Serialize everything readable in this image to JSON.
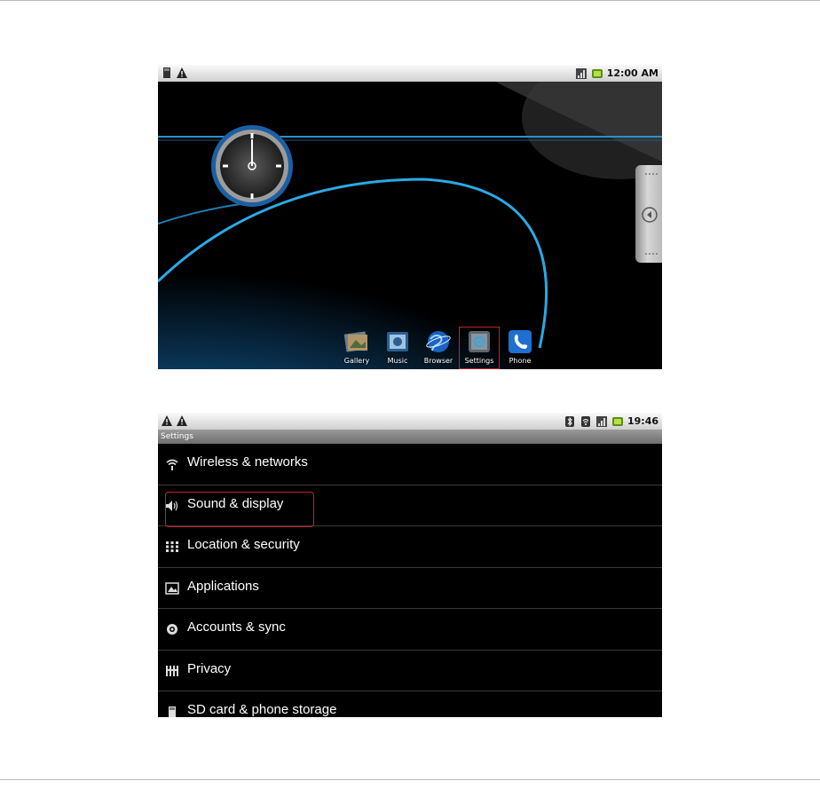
{
  "home": {
    "status_time": "12:00 AM",
    "dock": [
      {
        "label": "Gallery"
      },
      {
        "label": "Music"
      },
      {
        "label": "Browser"
      },
      {
        "label": "Settings"
      },
      {
        "label": "Phone"
      }
    ]
  },
  "settings": {
    "status_time": "19:46",
    "title": "Settings",
    "items": [
      {
        "label": "Wireless & networks"
      },
      {
        "label": "Sound & display"
      },
      {
        "label": "Location & security"
      },
      {
        "label": "Applications"
      },
      {
        "label": "Accounts & sync"
      },
      {
        "label": "Privacy"
      },
      {
        "label": "SD card & phone storage"
      }
    ]
  },
  "colors": {
    "highlight_red": "#c0242b",
    "accent_blue": "#2ba9e6"
  },
  "icons": {
    "home_status_left": [
      "sd-card-icon",
      "warning-icon"
    ],
    "home_status_right": [
      "signal-icon",
      "battery-icon"
    ],
    "settings_status_left": [
      "warning-icon",
      "warning-icon"
    ],
    "settings_status_right": [
      "bluetooth-icon",
      "wifi-icon",
      "signal-icon",
      "battery-icon"
    ]
  }
}
